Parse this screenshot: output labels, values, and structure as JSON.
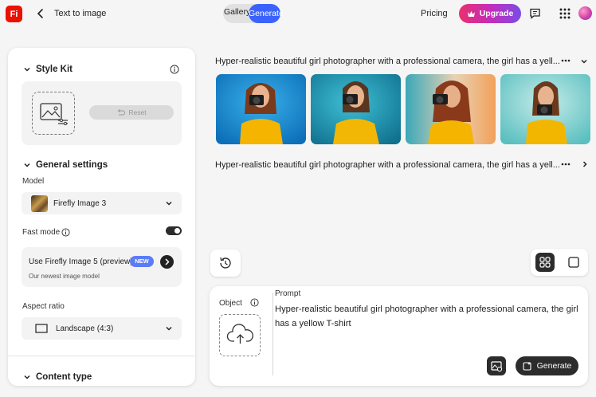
{
  "header": {
    "logo_text": "Fi",
    "title": "Text to image",
    "tabs": [
      {
        "label": "Gallery"
      },
      {
        "label": "Generate",
        "active": true
      }
    ],
    "pricing_label": "Pricing",
    "upgrade_label": "Upgrade",
    "accent": "#3b63fb",
    "brand": "#eb1000"
  },
  "sidebar": {
    "style_kit_title": "Style Kit",
    "reset_label": "Reset",
    "general_settings_title": "General settings",
    "model_label": "Model",
    "model_value": "Firefly Image 3",
    "fast_mode_label": "Fast mode",
    "fast_mode_on": true,
    "promo_title": "Use Firefly Image 5 (preview)",
    "promo_badge": "NEW",
    "promo_subtitle": "Our newest image model",
    "aspect_ratio_label": "Aspect ratio",
    "aspect_ratio_value": "Landscape (4:3)",
    "content_type_title": "Content type"
  },
  "results": {
    "prompt_1": "Hyper-realistic beautiful girl photographer with a professional camera, the girl has a yell...",
    "prompt_2": "Hyper-realistic beautiful girl photographer with a professional camera, the girl has a yell...",
    "more_icon": "more-horizontal-icon"
  },
  "composer": {
    "object_label": "Object",
    "prompt_label": "Prompt",
    "prompt_text": "Hyper-realistic beautiful girl photographer with a professional camera, the girl has a yellow T-shirt",
    "generate_label": "Generate"
  }
}
